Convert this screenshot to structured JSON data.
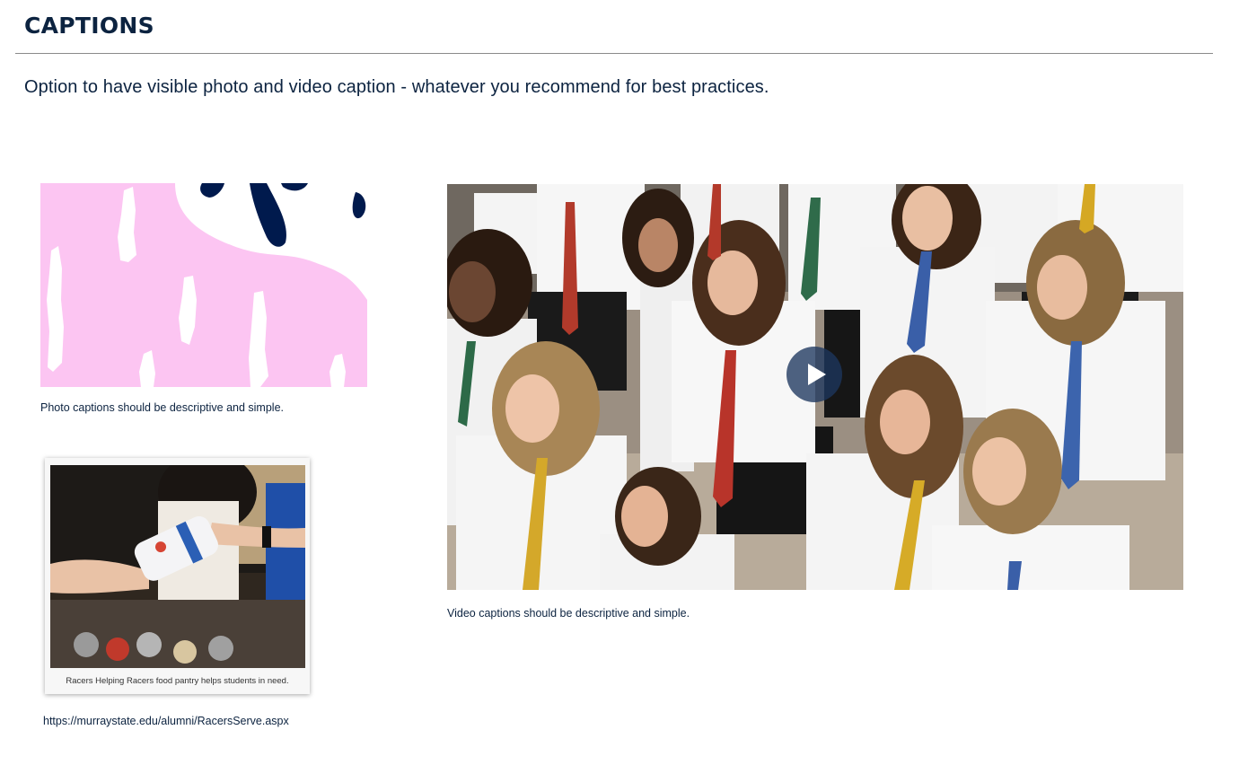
{
  "section": {
    "title": "CAPTIONS",
    "intro": "Option to have visible photo and video caption - whatever you recommend for best practices."
  },
  "photo_example": {
    "caption": "Photo captions should be descriptive and simple.",
    "colors": {
      "background": "#fcc5f2",
      "accent": "#0c2340"
    }
  },
  "polaroid_example": {
    "caption": "Racers Helping Racers food pantry helps students in need.",
    "link": "https://murraystate.edu/alumni/RacersServe.aspx"
  },
  "video_example": {
    "caption": "Video captions should be descriptive and simple.",
    "play_icon": "play-icon"
  },
  "colors": {
    "text": "#0c2340",
    "rule": "#8a8a8a"
  }
}
